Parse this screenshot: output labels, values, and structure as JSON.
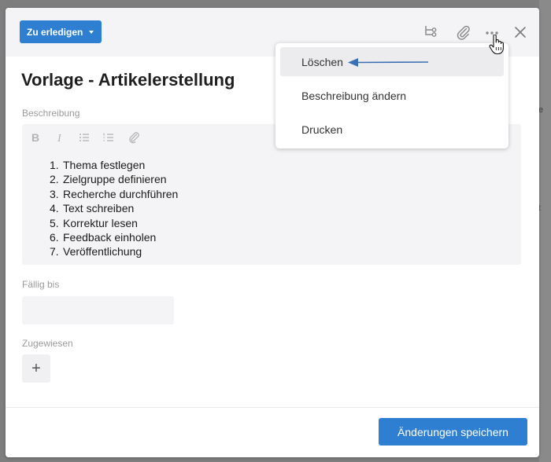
{
  "colors": {
    "accent": "#2e7fd1",
    "annotation_arrow": "#3b6fb4"
  },
  "background_app": {
    "fragments": [
      "e",
      "t"
    ]
  },
  "header": {
    "status_button_label": "Zu erledigen",
    "icons": [
      "subtasks-icon",
      "attachment-icon",
      "more-icon",
      "close-icon"
    ]
  },
  "task": {
    "title": "Vorlage - Artikelerstellung",
    "description_label": "Beschreibung",
    "description_items": [
      "Thema festlegen",
      "Zielgruppe definieren",
      "Recherche durchführen",
      "Text schreiben",
      "Korrektur lesen",
      "Feedback einholen",
      "Veröffentlichung"
    ],
    "due_label": "Fällig bis",
    "due_value": "",
    "assigned_label": "Zugewiesen",
    "add_assignee_symbol": "+"
  },
  "toolbar": {
    "tools": [
      "bold-icon",
      "italic-icon",
      "bullet-list-icon",
      "numbered-list-icon",
      "attach-icon"
    ]
  },
  "menu": {
    "items": [
      {
        "label": "Löschen",
        "highlighted": true
      },
      {
        "label": "Beschreibung ändern",
        "highlighted": false
      },
      {
        "label": "Drucken",
        "highlighted": false
      }
    ]
  },
  "footer": {
    "save_label": "Änderungen speichern"
  }
}
